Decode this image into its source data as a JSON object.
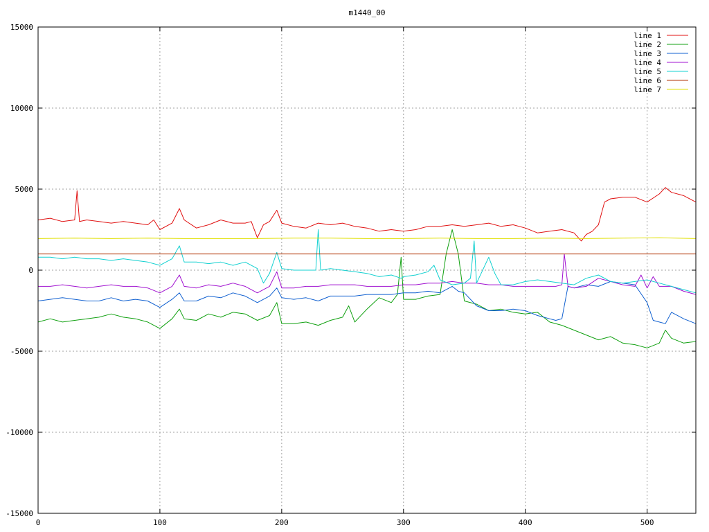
{
  "chart_data": {
    "type": "line",
    "title": "m1440_00",
    "xlabel": "",
    "ylabel": "",
    "xlim": [
      0,
      540
    ],
    "ylim": [
      -15000,
      15000
    ],
    "grid": true,
    "legend_position": "top-right",
    "x_ticks": [
      0,
      100,
      200,
      300,
      400,
      500
    ],
    "y_ticks": [
      -15000,
      -10000,
      -5000,
      0,
      5000,
      10000,
      15000
    ],
    "x_tick_labels": [
      "0",
      "100",
      "200",
      "300",
      "400",
      "500"
    ],
    "y_tick_labels": [
      "-15000",
      "-10000",
      "-5000",
      "0",
      "5000",
      "10000",
      "15000"
    ],
    "series": [
      {
        "name": "line 1",
        "color": "#e01010",
        "x": [
          0,
          10,
          20,
          30,
          32,
          34,
          40,
          50,
          60,
          70,
          80,
          90,
          95,
          100,
          110,
          116,
          120,
          130,
          140,
          150,
          160,
          170,
          175,
          180,
          185,
          190,
          196,
          200,
          210,
          220,
          230,
          240,
          250,
          260,
          270,
          280,
          290,
          300,
          310,
          320,
          330,
          340,
          350,
          360,
          370,
          380,
          390,
          400,
          410,
          420,
          430,
          440,
          446,
          450,
          455,
          460,
          465,
          470,
          480,
          490,
          500,
          510,
          515,
          520,
          530,
          540
        ],
        "y": [
          3100,
          3200,
          3000,
          3100,
          4900,
          3000,
          3100,
          3000,
          2900,
          3000,
          2900,
          2800,
          3100,
          2500,
          2900,
          3800,
          3100,
          2600,
          2800,
          3100,
          2900,
          2900,
          3000,
          2000,
          2800,
          3000,
          3700,
          2900,
          2700,
          2600,
          2900,
          2800,
          2900,
          2700,
          2600,
          2400,
          2500,
          2400,
          2500,
          2700,
          2700,
          2800,
          2700,
          2800,
          2900,
          2700,
          2800,
          2600,
          2300,
          2400,
          2500,
          2300,
          1800,
          2200,
          2400,
          2800,
          4200,
          4400,
          4500,
          4500,
          4200,
          4700,
          5100,
          4800,
          4600,
          4200
        ]
      },
      {
        "name": "line 2",
        "color": "#10a010",
        "x": [
          0,
          10,
          20,
          30,
          40,
          50,
          60,
          70,
          80,
          90,
          100,
          110,
          116,
          120,
          130,
          140,
          150,
          160,
          170,
          180,
          190,
          196,
          200,
          210,
          220,
          230,
          240,
          250,
          255,
          260,
          270,
          280,
          290,
          295,
          298,
          300,
          310,
          320,
          330,
          335,
          340,
          345,
          350,
          360,
          370,
          380,
          390,
          400,
          410,
          420,
          430,
          440,
          450,
          460,
          470,
          480,
          490,
          500,
          510,
          515,
          520,
          530,
          540
        ],
        "y": [
          -3200,
          -3000,
          -3200,
          -3100,
          -3000,
          -2900,
          -2700,
          -2900,
          -3000,
          -3200,
          -3600,
          -3000,
          -2400,
          -3000,
          -3100,
          -2700,
          -2900,
          -2600,
          -2700,
          -3100,
          -2800,
          -2000,
          -3300,
          -3300,
          -3200,
          -3400,
          -3100,
          -2900,
          -2200,
          -3200,
          -2400,
          -1700,
          -2000,
          -1500,
          800,
          -1800,
          -1800,
          -1600,
          -1500,
          1000,
          2500,
          1000,
          -1900,
          -2100,
          -2500,
          -2400,
          -2600,
          -2700,
          -2600,
          -3200,
          -3400,
          -3700,
          -4000,
          -4300,
          -4100,
          -4500,
          -4600,
          -4800,
          -4500,
          -3700,
          -4200,
          -4500,
          -4400
        ]
      },
      {
        "name": "line 3",
        "color": "#1060d0",
        "x": [
          0,
          10,
          20,
          30,
          40,
          50,
          60,
          70,
          80,
          90,
          100,
          110,
          116,
          120,
          130,
          140,
          150,
          160,
          170,
          180,
          190,
          196,
          200,
          210,
          220,
          230,
          240,
          250,
          260,
          270,
          280,
          290,
          300,
          310,
          320,
          330,
          340,
          345,
          350,
          360,
          370,
          380,
          390,
          400,
          410,
          420,
          425,
          430,
          435,
          440,
          450,
          460,
          470,
          480,
          490,
          500,
          505,
          510,
          515,
          520,
          530,
          540
        ],
        "y": [
          -1900,
          -1800,
          -1700,
          -1800,
          -1900,
          -1900,
          -1700,
          -1900,
          -1800,
          -1900,
          -2300,
          -1800,
          -1400,
          -1900,
          -1900,
          -1600,
          -1700,
          -1400,
          -1600,
          -2000,
          -1600,
          -1100,
          -1700,
          -1800,
          -1700,
          -1900,
          -1600,
          -1600,
          -1600,
          -1500,
          -1500,
          -1500,
          -1400,
          -1400,
          -1300,
          -1400,
          -1000,
          -1300,
          -1400,
          -2200,
          -2500,
          -2500,
          -2400,
          -2500,
          -2800,
          -3000,
          -3100,
          -3000,
          -1000,
          -1100,
          -900,
          -1000,
          -700,
          -800,
          -900,
          -2000,
          -3100,
          -3200,
          -3300,
          -2600,
          -3000,
          -3300
        ]
      },
      {
        "name": "line 4",
        "color": "#a010d0",
        "x": [
          0,
          10,
          20,
          30,
          40,
          50,
          60,
          70,
          80,
          90,
          100,
          110,
          116,
          120,
          130,
          140,
          150,
          160,
          170,
          180,
          190,
          196,
          200,
          210,
          220,
          230,
          240,
          250,
          260,
          270,
          280,
          290,
          300,
          310,
          320,
          330,
          340,
          350,
          360,
          370,
          380,
          390,
          400,
          410,
          420,
          425,
          430,
          432,
          435,
          440,
          450,
          460,
          470,
          480,
          490,
          495,
          500,
          505,
          510,
          520,
          530,
          540
        ],
        "y": [
          -1000,
          -1000,
          -900,
          -1000,
          -1100,
          -1000,
          -900,
          -1000,
          -1000,
          -1100,
          -1400,
          -1000,
          -300,
          -1000,
          -1100,
          -900,
          -1000,
          -800,
          -1000,
          -1400,
          -1000,
          -100,
          -1100,
          -1100,
          -1000,
          -1000,
          -900,
          -900,
          -900,
          -1000,
          -1000,
          -1000,
          -900,
          -900,
          -800,
          -800,
          -700,
          -800,
          -800,
          -900,
          -900,
          -1000,
          -1000,
          -1000,
          -1000,
          -1000,
          -900,
          1000,
          -1000,
          -1100,
          -1000,
          -500,
          -700,
          -900,
          -1000,
          -300,
          -1100,
          -400,
          -1000,
          -1000,
          -1300,
          -1500
        ]
      },
      {
        "name": "line 5",
        "color": "#10d0d0",
        "x": [
          0,
          10,
          20,
          30,
          40,
          50,
          60,
          70,
          80,
          90,
          100,
          110,
          116,
          120,
          130,
          140,
          150,
          160,
          170,
          180,
          185,
          190,
          196,
          200,
          210,
          220,
          228,
          230,
          232,
          240,
          250,
          260,
          270,
          280,
          290,
          298,
          300,
          310,
          320,
          325,
          330,
          340,
          350,
          355,
          358,
          360,
          370,
          375,
          380,
          390,
          400,
          410,
          420,
          430,
          440,
          450,
          460,
          470,
          480,
          490,
          500,
          510,
          520,
          530,
          540
        ],
        "y": [
          800,
          800,
          700,
          800,
          700,
          700,
          600,
          700,
          600,
          500,
          300,
          700,
          1500,
          500,
          500,
          400,
          500,
          300,
          500,
          100,
          -800,
          -200,
          1100,
          100,
          0,
          0,
          0,
          2500,
          0,
          100,
          0,
          -100,
          -200,
          -400,
          -300,
          -500,
          -400,
          -300,
          -100,
          300,
          -600,
          -900,
          -800,
          -500,
          1800,
          -800,
          800,
          -200,
          -900,
          -900,
          -700,
          -600,
          -700,
          -800,
          -900,
          -500,
          -300,
          -700,
          -800,
          -700,
          -600,
          -800,
          -1000,
          -1200,
          -1400
        ]
      },
      {
        "name": "line 6",
        "color": "#b03000",
        "x": [
          0,
          30,
          60,
          90,
          120,
          150,
          180,
          210,
          240,
          270,
          300,
          330,
          360,
          390,
          420,
          450,
          480,
          510,
          540
        ],
        "y": [
          1000,
          1000,
          1000,
          1000,
          1000,
          1000,
          1000,
          1000,
          1000,
          1000,
          1000,
          1000,
          1000,
          1000,
          1000,
          1000,
          1000,
          1000,
          1000
        ]
      },
      {
        "name": "line 7",
        "color": "#e0e000",
        "x": [
          0,
          30,
          60,
          90,
          120,
          150,
          180,
          210,
          240,
          270,
          300,
          330,
          360,
          390,
          420,
          450,
          480,
          510,
          540
        ],
        "y": [
          1950,
          1980,
          1950,
          1980,
          1950,
          1950,
          1950,
          1980,
          1980,
          1950,
          1950,
          1980,
          1950,
          1950,
          1980,
          1950,
          1980,
          2000,
          1950
        ]
      }
    ]
  }
}
